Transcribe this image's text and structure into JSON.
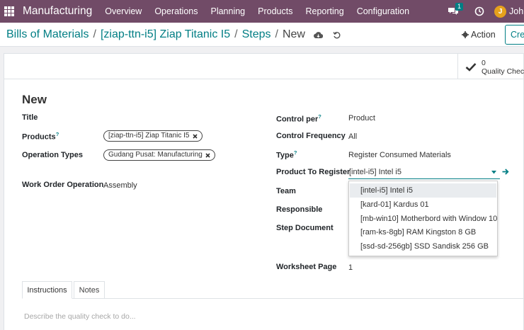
{
  "navbar": {
    "app_name": "Manufacturing",
    "menu": [
      "Overview",
      "Operations",
      "Planning",
      "Products",
      "Reporting",
      "Configuration"
    ],
    "chat_badge": "1",
    "user_initial": "J",
    "user_name": "John",
    "bg_color": "#714B67"
  },
  "breadcrumb": {
    "items": [
      "Bills of Materials",
      "[ziap-ttn-i5] Ziap Titanic I5",
      "Steps"
    ],
    "current": "New",
    "separator": "/"
  },
  "actions": {
    "action_label": "Action",
    "create_label": "Create"
  },
  "stat_button": {
    "value": "0",
    "label": "Quality Checks"
  },
  "form": {
    "title": "New",
    "left": {
      "title_label": "Title",
      "products_label": "Products",
      "products_tag": "[ziap-ttn-i5] Ziap Titanic I5",
      "operation_types_label": "Operation Types",
      "operation_types_tag": "Gudang Pusat: Manufacturing",
      "work_order_operation_label": "Work Order Operation",
      "work_order_operation_value": "Assembly"
    },
    "right": {
      "control_per_label": "Control per",
      "control_per_value": "Product",
      "control_frequency_label": "Control Frequency",
      "control_frequency_value": "All",
      "type_label": "Type",
      "type_value": "Register Consumed Materials",
      "product_to_register_label": "Product To Register",
      "product_to_register_value": "[intel-i5] Intel i5",
      "team_label": "Team",
      "responsible_label": "Responsible",
      "step_document_label": "Step Document",
      "worksheet_page_label": "Worksheet Page",
      "worksheet_page_value": "1"
    },
    "help_mark": "?"
  },
  "dropdown": {
    "options": [
      "[intel-i5] Intel i5",
      "[kard-01] Kardus 01",
      "[mb-win10] Motherbord with Window 10",
      "[ram-ks-8gb] RAM Kingston 8 GB",
      "[ssd-sd-256gb] SSD Sandisk 256 GB"
    ],
    "highlighted": "[intel-i5] Intel i5"
  },
  "tabs": {
    "items": [
      "Instructions",
      "Notes"
    ],
    "active": "Instructions",
    "instructions_placeholder": "Describe the quality check to do..."
  },
  "colors": {
    "accent": "#017e84",
    "brand": "#714B67",
    "avatar": "#e6a11c"
  }
}
